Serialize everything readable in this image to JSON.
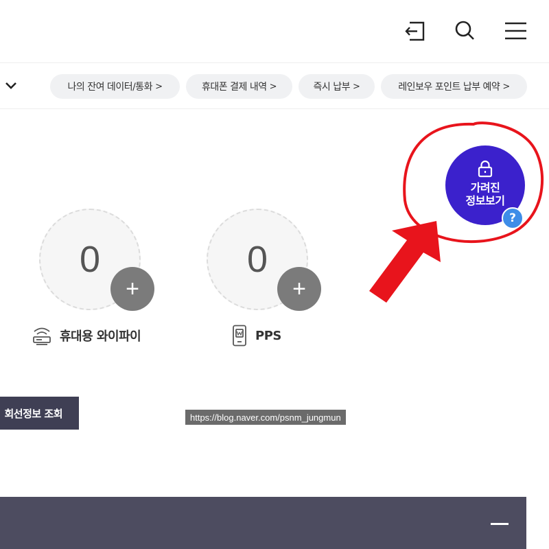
{
  "header": {
    "logout_icon": "logout-icon",
    "search_icon": "search-icon",
    "menu_icon": "hamburger-menu-icon"
  },
  "quick_links": [
    {
      "label": "나의 잔여 데이터/통화"
    },
    {
      "label": "휴대폰 결제 내역"
    },
    {
      "label": "즉시 납부"
    },
    {
      "label": "레인보우 포인트 납부 예약"
    }
  ],
  "chip_chevron": ">",
  "devices": [
    {
      "count": "0",
      "label": "휴대용 와이파이",
      "icon": "wifi-router-icon"
    },
    {
      "count": "0",
      "label": "PPS",
      "icon": "phone-device-icon"
    }
  ],
  "plus_symbol": "+",
  "line_info_button": "회선정보 조회",
  "hidden_info": {
    "label_line1": "가려진",
    "label_line2": "정보보기",
    "help": "?"
  },
  "watermark": "https://blog.naver.com/psnm_jungmun",
  "colors": {
    "hidden_info_button": "#3b21cc",
    "help_badge": "#3e8de8",
    "annotation_red": "#e8141c",
    "bottom_panel": "#4d4c60",
    "line_info_button": "#3f3f54"
  }
}
